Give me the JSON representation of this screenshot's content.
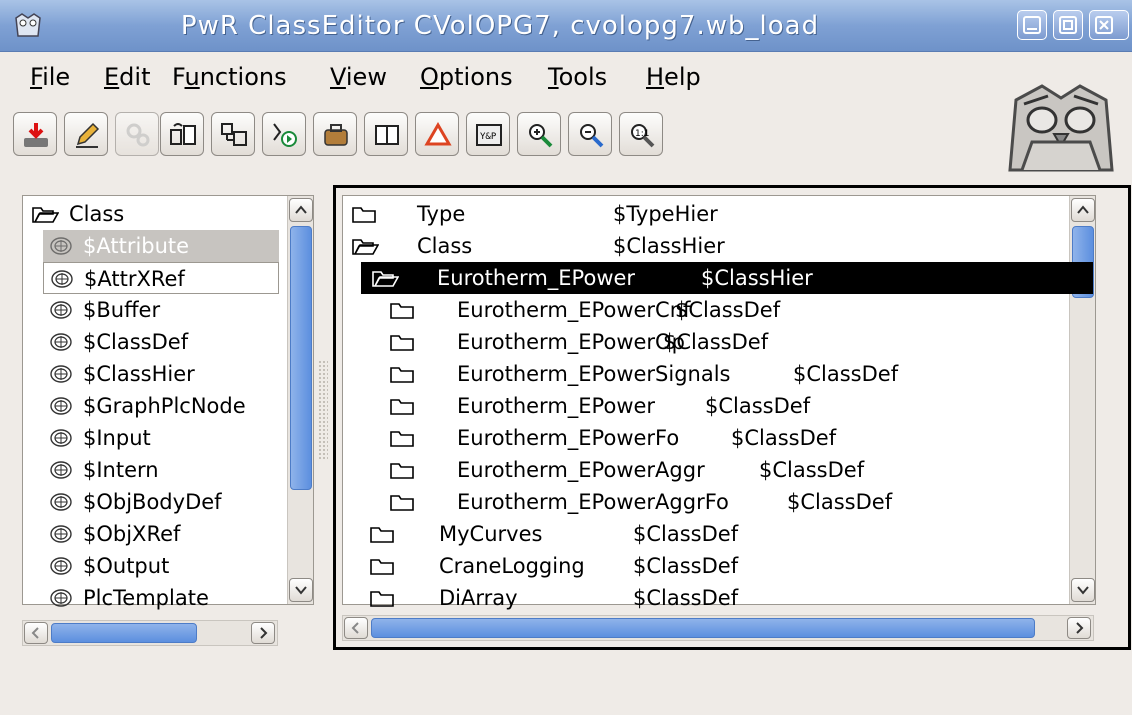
{
  "window": {
    "title": "PwR ClassEditor CVolOPG7,   cvolopg7.wb_load"
  },
  "menu": [
    {
      "label": "File",
      "u": "F",
      "rest": "ile"
    },
    {
      "label": "Edit",
      "u": "E",
      "rest": "dit"
    },
    {
      "label": "Functions",
      "pre": "F",
      "u": "u",
      "rest": "nctions"
    },
    {
      "label": "View",
      "u": "V",
      "rest": "iew"
    },
    {
      "label": "Options",
      "u": "O",
      "rest": "ptions"
    },
    {
      "label": "Tools",
      "u": "T",
      "rest": "ools"
    },
    {
      "label": "Help",
      "u": "H",
      "rest": "elp"
    }
  ],
  "toolbar": [
    "save-icon",
    "edit-pencil-icon",
    "build-gears-icon",
    "copy-object-icon",
    "paste-object-icon",
    "open-plc-icon",
    "open-object-icon",
    "split-view-icon",
    "alarm-triangle-icon",
    "crossref-icon",
    "zoom-in-icon",
    "zoom-out-icon",
    "zoom-reset-icon"
  ],
  "left_tree": {
    "root": "Class",
    "items": [
      {
        "label": "$Attribute",
        "state": "selected"
      },
      {
        "label": "$AttrXRef",
        "state": "focused"
      },
      {
        "label": "$Buffer"
      },
      {
        "label": "$ClassDef"
      },
      {
        "label": "$ClassHier"
      },
      {
        "label": "$GraphPlcNode"
      },
      {
        "label": "$Input"
      },
      {
        "label": "$Intern"
      },
      {
        "label": "$ObjBodyDef"
      },
      {
        "label": "$ObjXRef"
      },
      {
        "label": "$Output"
      },
      {
        "label": "PlcTemplate"
      }
    ]
  },
  "right_tree": {
    "rows": [
      {
        "name": "Type",
        "type": "$TypeHier",
        "icon": "folder-closed"
      },
      {
        "name": "Class",
        "type": "$ClassHier",
        "icon": "folder-open"
      },
      {
        "name": "Eurotherm_EPower",
        "type": "$ClassHier",
        "icon": "folder-open",
        "selected": true
      },
      {
        "name": "Eurotherm_EPowerCnf",
        "type": "$ClassDef",
        "icon": "folder-closed"
      },
      {
        "name": "Eurotherm_EPowerOp",
        "type": "$ClassDef",
        "icon": "folder-closed"
      },
      {
        "name": "Eurotherm_EPowerSignals",
        "type": "$ClassDef",
        "icon": "folder-closed"
      },
      {
        "name": "Eurotherm_EPower",
        "type": "$ClassDef",
        "icon": "folder-closed"
      },
      {
        "name": "Eurotherm_EPowerFo",
        "type": "$ClassDef",
        "icon": "folder-closed"
      },
      {
        "name": "Eurotherm_EPowerAggr",
        "type": "$ClassDef",
        "icon": "folder-closed"
      },
      {
        "name": "Eurotherm_EPowerAggrFo",
        "type": "$ClassDef",
        "icon": "folder-closed"
      },
      {
        "name": "MyCurves",
        "type": "$ClassDef",
        "icon": "folder-closed"
      },
      {
        "name": "CraneLogging",
        "type": "$ClassDef",
        "icon": "folder-closed"
      },
      {
        "name": "DiArray",
        "type": "$ClassDef",
        "icon": "folder-closed"
      }
    ]
  },
  "colors": {
    "title_bar": "#7fa1d4",
    "selection": "#000000",
    "scroll_thumb": "#5c8fdf"
  }
}
